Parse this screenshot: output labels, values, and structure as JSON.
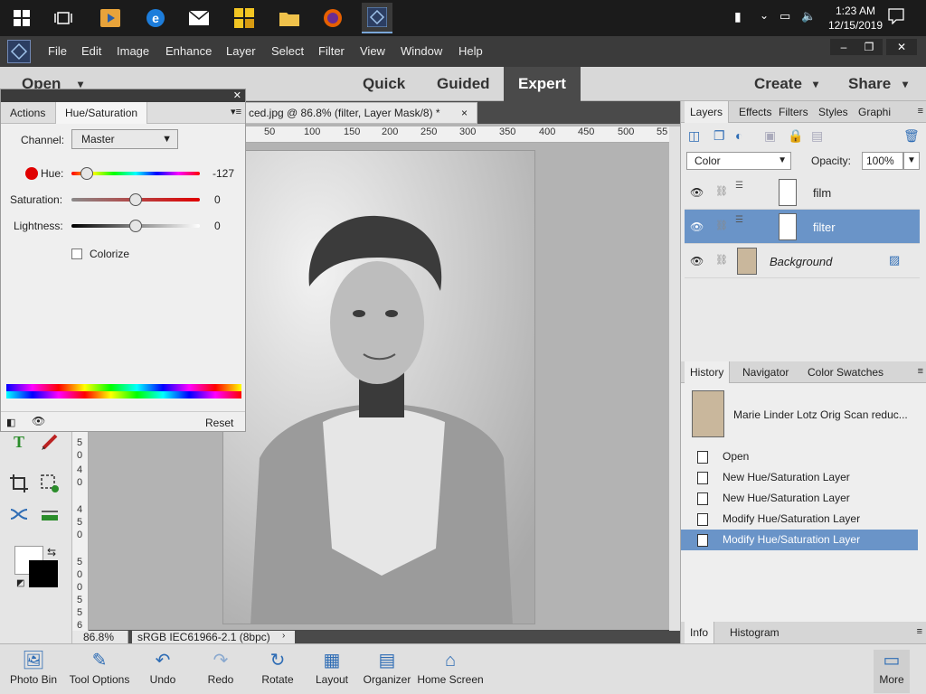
{
  "taskbar": {
    "time": "1:23 AM",
    "date": "12/15/2019"
  },
  "menubar": {
    "items": [
      "File",
      "Edit",
      "Image",
      "Enhance",
      "Layer",
      "Select",
      "Filter",
      "View",
      "Window",
      "Help"
    ],
    "window_controls": [
      "–",
      "❐",
      "✕"
    ]
  },
  "modebar": {
    "open_label": "Open",
    "modes": [
      "Quick",
      "Guided",
      "Expert"
    ],
    "create_label": "Create",
    "share_label": "Share"
  },
  "document": {
    "tab_title": "ced.jpg @ 86.8% (filter, Layer Mask/8) *",
    "close_glyph": "×",
    "zoom": "86.8%",
    "color_profile": "sRGB IEC61966-2.1 (8bpc)",
    "ruler_h": [
      "50",
      "100",
      "150",
      "200",
      "250",
      "300",
      "350",
      "400",
      "450",
      "500",
      "55"
    ],
    "ruler_v": [
      "5",
      "0",
      "4",
      "0",
      "4",
      "5",
      "0",
      "5",
      "0",
      "0",
      "5",
      "5",
      "0",
      "6"
    ]
  },
  "huesat": {
    "tabs": [
      "Actions",
      "Hue/Saturation"
    ],
    "channel_label": "Channel:",
    "channel_value": "Master",
    "hue_label": "Hue:",
    "hue_value": "-127",
    "hue_fraction": 0.12,
    "saturation_label": "Saturation:",
    "saturation_value": "0",
    "saturation_fraction": 0.5,
    "lightness_label": "Lightness:",
    "lightness_value": "0",
    "lightness_fraction": 0.5,
    "colorize_label": "Colorize",
    "reset_label": "Reset"
  },
  "layers_panel": {
    "tabs": [
      "Layers",
      "Effects",
      "Filters",
      "Styles",
      "Graphi"
    ],
    "blend_mode": "Color",
    "opacity_label": "Opacity:",
    "opacity_value": "100%",
    "layers": [
      {
        "name": "film",
        "selected": false
      },
      {
        "name": "filter",
        "selected": true
      },
      {
        "name": "Background",
        "selected": false
      }
    ]
  },
  "history_panel": {
    "tabs": [
      "History",
      "Navigator",
      "Color Swatches"
    ],
    "snapshot_label": "Marie Linder Lotz Orig Scan reduc...",
    "steps": [
      "Open",
      "New Hue/Saturation Layer",
      "New Hue/Saturation Layer",
      "Modify Hue/Saturation Layer",
      "Modify Hue/Saturation Layer"
    ],
    "selected_index": 4
  },
  "info_panel": {
    "tabs": [
      "Info",
      "Histogram"
    ]
  },
  "bottombar": {
    "buttons": [
      "Photo Bin",
      "Tool Options",
      "Undo",
      "Redo",
      "Rotate",
      "Layout",
      "Organizer",
      "Home Screen"
    ],
    "more_label": "More"
  },
  "colors": {
    "accent": "#6a94c8",
    "taskbar": "#1b1b1b",
    "menubar": "#3b3b3b"
  }
}
